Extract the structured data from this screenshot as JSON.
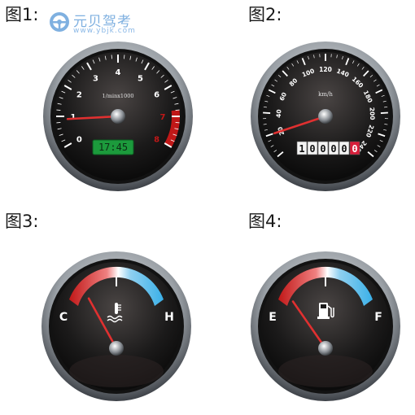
{
  "labels": {
    "fig1": "图1:",
    "fig2": "图2:",
    "fig3": "图3:",
    "fig4": "图4:"
  },
  "watermark": {
    "title": "元贝驾考",
    "url": "www.ybjk.com"
  },
  "tachometer": {
    "ticks": [
      "0",
      "1",
      "2",
      "3",
      "4",
      "5",
      "6",
      "7",
      "8"
    ],
    "unit": "1/minx1000",
    "clock": "17:45",
    "value": 0.9
  },
  "speedometer": {
    "ticks": [
      "20",
      "40",
      "60",
      "80",
      "100",
      "120",
      "140",
      "160",
      "180",
      "200",
      "220",
      "240"
    ],
    "unit": "km/h",
    "odometer": [
      "1",
      "0",
      "0",
      "0",
      "0"
    ],
    "odometer_last": "0",
    "value": 20
  },
  "temperature": {
    "low": "C",
    "high": "H",
    "icon": "coolant-temperature-icon",
    "level": 0.25
  },
  "fuel": {
    "low": "E",
    "high": "F",
    "icon": "fuel-pump-icon",
    "level": 0.2
  },
  "colors": {
    "needle": "#e03030",
    "redzone": "#c01818",
    "cold": "#3ab0e8",
    "clock_bg": "#1c9a3c"
  }
}
